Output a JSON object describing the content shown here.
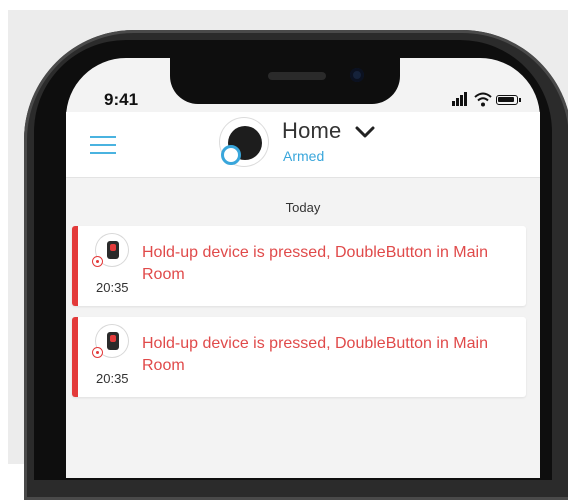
{
  "status_bar": {
    "time": "9:41"
  },
  "header": {
    "title": "Home",
    "status": "Armed",
    "accent_color": "#39a6db",
    "icons": {
      "menu": "hamburger-menu-icon",
      "hub": "hub-device-icon",
      "dropdown": "chevron-down-icon"
    }
  },
  "feed": {
    "section_label": "Today",
    "alert_color": "#e33a3a",
    "events": [
      {
        "text": "Hold-up device is pressed, DoubleButton in Main Room",
        "time": "20:35",
        "icon": "doublebutton-device-icon"
      },
      {
        "text": "Hold-up device is pressed, DoubleButton in Main Room",
        "time": "20:35",
        "icon": "doublebutton-device-icon"
      }
    ]
  }
}
